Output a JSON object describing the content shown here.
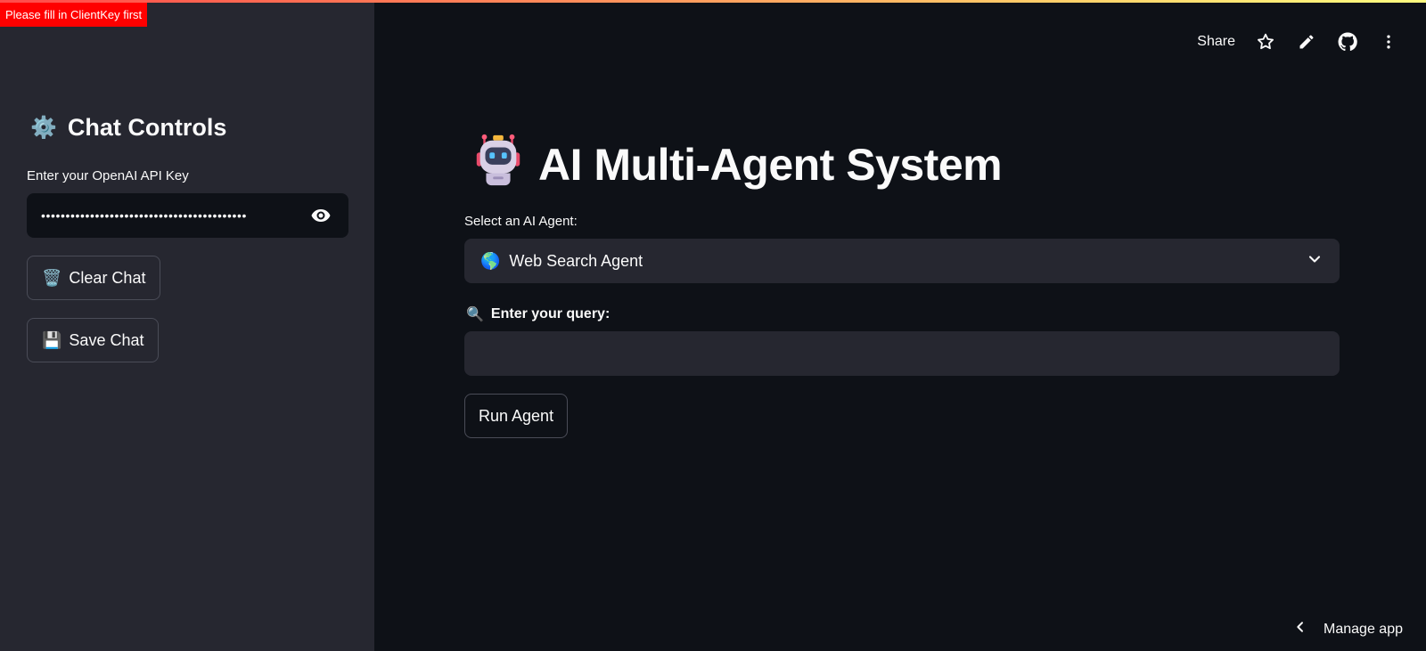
{
  "toast": {
    "text": "Please fill in ClientKey first"
  },
  "sidebar": {
    "title_icon": "⚙️",
    "title": "Chat Controls",
    "api_key_label": "Enter your OpenAI API Key",
    "api_key_value": "••••••••••••••••••••••••••••••••••••••••••",
    "clear_icon": "🗑️",
    "clear_label": "Clear Chat",
    "save_icon": "💾",
    "save_label": "Save Chat"
  },
  "header": {
    "share_label": "Share",
    "icons": [
      "star-icon",
      "pencil-icon",
      "github-icon",
      "more-vert-icon"
    ]
  },
  "main": {
    "title": "AI Multi-Agent System",
    "title_icon": "robot-icon",
    "agent_label": "Select an AI Agent:",
    "agent_icon": "🌎",
    "agent_value": "Web Search Agent",
    "query_icon": "🔍",
    "query_label": "Enter your query:",
    "query_value": "",
    "run_label": "Run Agent"
  },
  "footer": {
    "manage_label": "Manage app"
  },
  "colors": {
    "background": "#0e1117",
    "sidebar": "#262730",
    "input": "#262730",
    "toast": "#ff0000",
    "accent_gradient_start": "#ff4b4b",
    "accent_gradient_end": "#fffd80"
  }
}
